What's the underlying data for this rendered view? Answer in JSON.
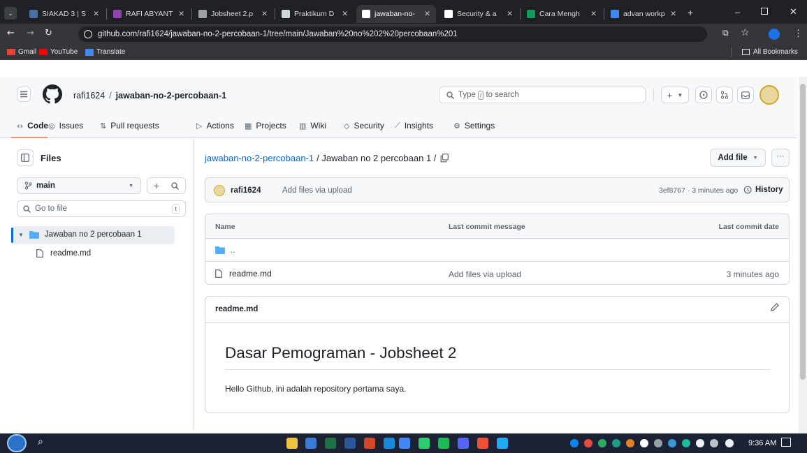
{
  "browser": {
    "tabs": [
      {
        "label": "SIAKAD 3 | S",
        "color": "#4a6fa5"
      },
      {
        "label": "RAFI ABYANT",
        "color": "#8e44ad"
      },
      {
        "label": "Jobsheet 2.p",
        "color": "#9aa0a6"
      },
      {
        "label": "Praktikum D",
        "color": "#cfd8dc"
      },
      {
        "label": "jawaban-no-",
        "color": "#ffffff"
      },
      {
        "label": "Security & a",
        "color": "#ffffff"
      },
      {
        "label": "Cara Mengh",
        "color": "#0f9d58"
      },
      {
        "label": "advan workp",
        "color": "#4285f4"
      }
    ],
    "active_tab_index": 4,
    "url": "github.com/rafi1624/jawaban-no-2-percobaan-1/tree/main/Jawaban%20no%202%20percobaan%201",
    "bookmarks": [
      "Gmail",
      "YouTube",
      "Translate"
    ],
    "all_bookmarks": "All Bookmarks"
  },
  "repo": {
    "owner": "rafi1624",
    "separator": "/",
    "name": "jawaban-no-2-percobaan-1",
    "search_prefix": "Type",
    "search_key": "/",
    "search_suffix": "to search"
  },
  "nav": [
    {
      "label": "Code",
      "icon": "code-icon",
      "selected": true
    },
    {
      "label": "Issues",
      "icon": "issue-icon"
    },
    {
      "label": "Pull requests",
      "icon": "pull-request-icon"
    },
    {
      "label": "Actions",
      "icon": "play-icon"
    },
    {
      "label": "Projects",
      "icon": "table-icon"
    },
    {
      "label": "Wiki",
      "icon": "book-icon"
    },
    {
      "label": "Security",
      "icon": "shield-icon"
    },
    {
      "label": "Insights",
      "icon": "graph-icon"
    },
    {
      "label": "Settings",
      "icon": "gear-icon"
    }
  ],
  "sidebar": {
    "title": "Files",
    "branch": "main",
    "go_to_file": "Go to file",
    "shortcut": "t",
    "tree": [
      {
        "label": "Jawaban no 2 percobaan 1",
        "type": "folder"
      },
      {
        "label": "readme.md",
        "type": "file"
      }
    ]
  },
  "main": {
    "breadcrumb_repo": "jawaban-no-2-percobaan-1",
    "breadcrumb_rest": "/ Jawaban no 2 percobaan 1 /",
    "add_file": "Add file",
    "commit": {
      "author": "rafi1624",
      "message": "Add files via upload",
      "sha_time": "3ef8767 · 3 minutes ago",
      "history": "History"
    },
    "table": {
      "headers": [
        "Name",
        "Last commit message",
        "Last commit date"
      ],
      "parent": "..",
      "rows": [
        {
          "name": "readme.md",
          "message": "Add files via upload",
          "date": "3 minutes ago"
        }
      ]
    },
    "readme": {
      "filename": "readme.md",
      "heading": "Dasar Pemograman - Jobsheet 2",
      "body": "Hello Github, ini adalah repository pertama saya."
    }
  },
  "taskbar": {
    "time": "9:36 AM"
  }
}
